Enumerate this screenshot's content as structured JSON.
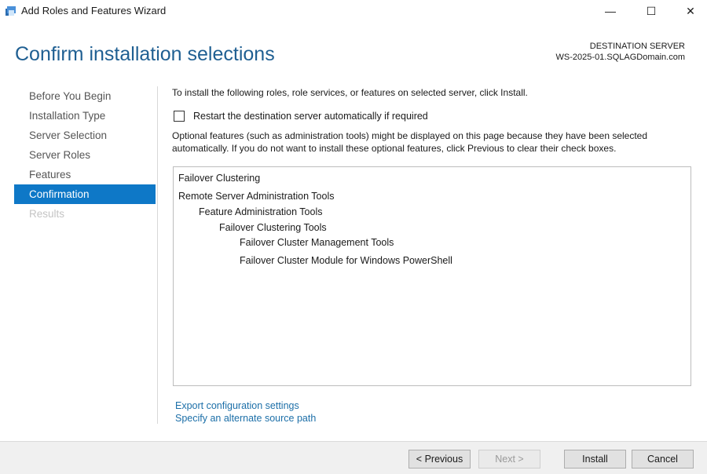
{
  "window": {
    "title": "Add Roles and Features Wizard",
    "minimize_glyph": "—",
    "maximize_glyph": "☐",
    "close_glyph": "✕"
  },
  "header": {
    "title": "Confirm installation selections",
    "destination_label": "DESTINATION SERVER",
    "destination_server": "WS-2025-01.SQLAGDomain.com"
  },
  "nav": {
    "items": [
      {
        "label": "Before You Begin",
        "state": "normal"
      },
      {
        "label": "Installation Type",
        "state": "normal"
      },
      {
        "label": "Server Selection",
        "state": "normal"
      },
      {
        "label": "Server Roles",
        "state": "normal"
      },
      {
        "label": "Features",
        "state": "normal"
      },
      {
        "label": "Confirmation",
        "state": "active"
      },
      {
        "label": "Results",
        "state": "disabled"
      }
    ]
  },
  "content": {
    "intro": "To install the following roles, role services, or features on selected server, click Install.",
    "restart_checkbox_label": "Restart the destination server automatically if required",
    "restart_checked": false,
    "optional_note": "Optional features (such as administration tools) might be displayed on this page because they have been selected automatically. If you do not want to install these optional features, click Previous to clear their check boxes.",
    "features": [
      {
        "label": "Failover Clustering",
        "level": 0
      },
      {
        "label": "Remote Server Administration Tools",
        "level": 0
      },
      {
        "label": "Feature Administration Tools",
        "level": 1
      },
      {
        "label": "Failover Clustering Tools",
        "level": 2
      },
      {
        "label": "Failover Cluster Management Tools",
        "level": 3
      },
      {
        "label": "Failover Cluster Module for Windows PowerShell",
        "level": 3
      }
    ],
    "export_link": "Export configuration settings",
    "source_path_link": "Specify an alternate source path"
  },
  "footer": {
    "previous_label": "< Previous",
    "next_label": "Next >",
    "install_label": "Install",
    "cancel_label": "Cancel"
  },
  "colors": {
    "accent": "#0e78c7",
    "header_title": "#1f5f92",
    "link": "#1c6fa8"
  }
}
